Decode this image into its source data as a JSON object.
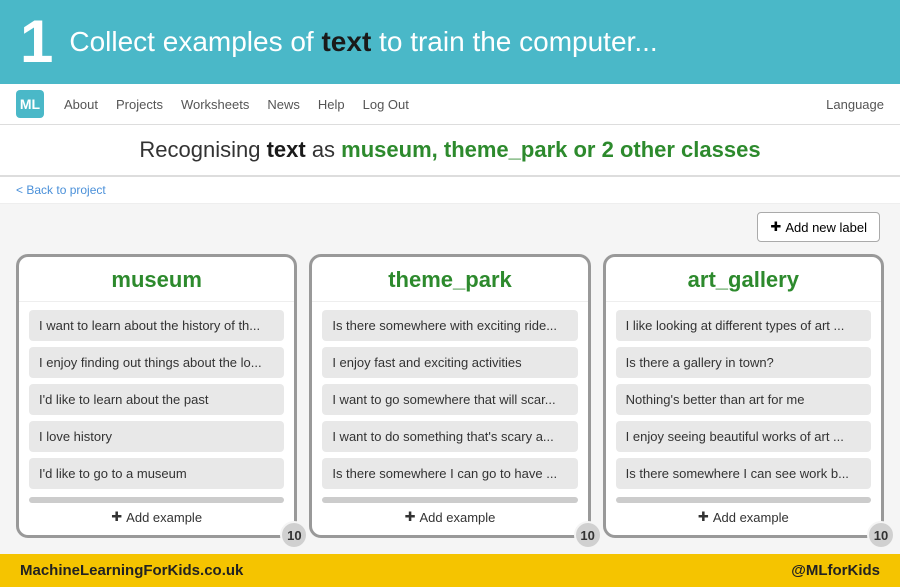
{
  "banner": {
    "step": "1",
    "prefix": "Collect examples of ",
    "highlight": "text",
    "suffix": " to train the computer..."
  },
  "nav": {
    "links": [
      "About",
      "Projects",
      "Worksheets",
      "News",
      "Help",
      "Log Out"
    ],
    "language": "Language"
  },
  "subtitle": {
    "prefix": "Recognising ",
    "word": "text",
    "middle": " as ",
    "classes": "museum, theme_park or 2 other classes"
  },
  "back_link": "< Back to project",
  "add_label_button": "Add new label",
  "columns": [
    {
      "label": "museum",
      "items": [
        "I want to learn about the history of th...",
        "I enjoy finding out things about the lo...",
        "I'd like to learn about the past",
        "I love history",
        "I'd like to go to a museum"
      ],
      "add_label": "Add example",
      "count": "10"
    },
    {
      "label": "theme_park",
      "items": [
        "Is there somewhere with exciting ride...",
        "I enjoy fast and exciting activities",
        "I want to go somewhere that will scar...",
        "I want to do something that's scary a...",
        "Is there somewhere I can go to have ..."
      ],
      "add_label": "Add example",
      "count": "10"
    },
    {
      "label": "art_gallery",
      "items": [
        "I like looking at different types of art ...",
        "Is there a gallery in town?",
        "Nothing's better than art for me",
        "I enjoy seeing beautiful works of art ...",
        "Is there somewhere I can see work b..."
      ],
      "add_label": "Add example",
      "count": "10"
    }
  ],
  "footer": {
    "left": "MachineLearningForKids.co.uk",
    "right": "@MLforKids"
  }
}
